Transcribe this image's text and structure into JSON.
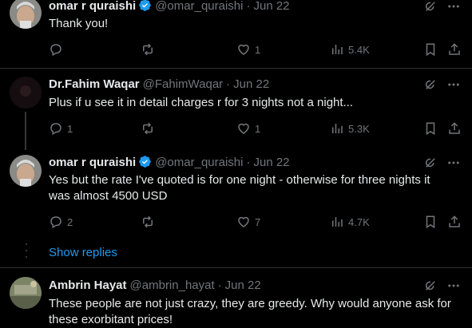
{
  "tweets": [
    {
      "name": "omar r quraishi",
      "verified": true,
      "handle": "@omar_quraishi",
      "date": "Jun 22",
      "text": "Thank you!",
      "replies": "",
      "reposts": "",
      "likes": "1",
      "views": "5.4K"
    },
    {
      "name": "Dr.Fahim Waqar",
      "verified": false,
      "handle": "@FahimWaqar",
      "date": "Jun 22",
      "text": "Plus if u see it in detail charges r for 3 nights not a night...",
      "replies": "1",
      "reposts": "",
      "likes": "1",
      "views": "5.3K"
    },
    {
      "name": "omar r quraishi",
      "verified": true,
      "handle": "@omar_quraishi",
      "date": "Jun 22",
      "text": "Yes but the rate I've quoted is for one night - otherwise for three nights it was almost 4500 USD",
      "replies": "2",
      "reposts": "",
      "likes": "7",
      "views": "4.7K"
    },
    {
      "name": "Ambrin Hayat",
      "verified": false,
      "handle": "@ambrin_hayat",
      "date": "Jun 22",
      "text": "These people are not just crazy, they are greedy. Why would anyone ask for these exorbitant prices!"
    }
  ],
  "show_replies_label": "Show replies",
  "dot_separator": "·",
  "colors": {
    "accent": "#1d9bf0",
    "muted": "#71767b",
    "text": "#e7e9ea",
    "background": "#000000"
  }
}
